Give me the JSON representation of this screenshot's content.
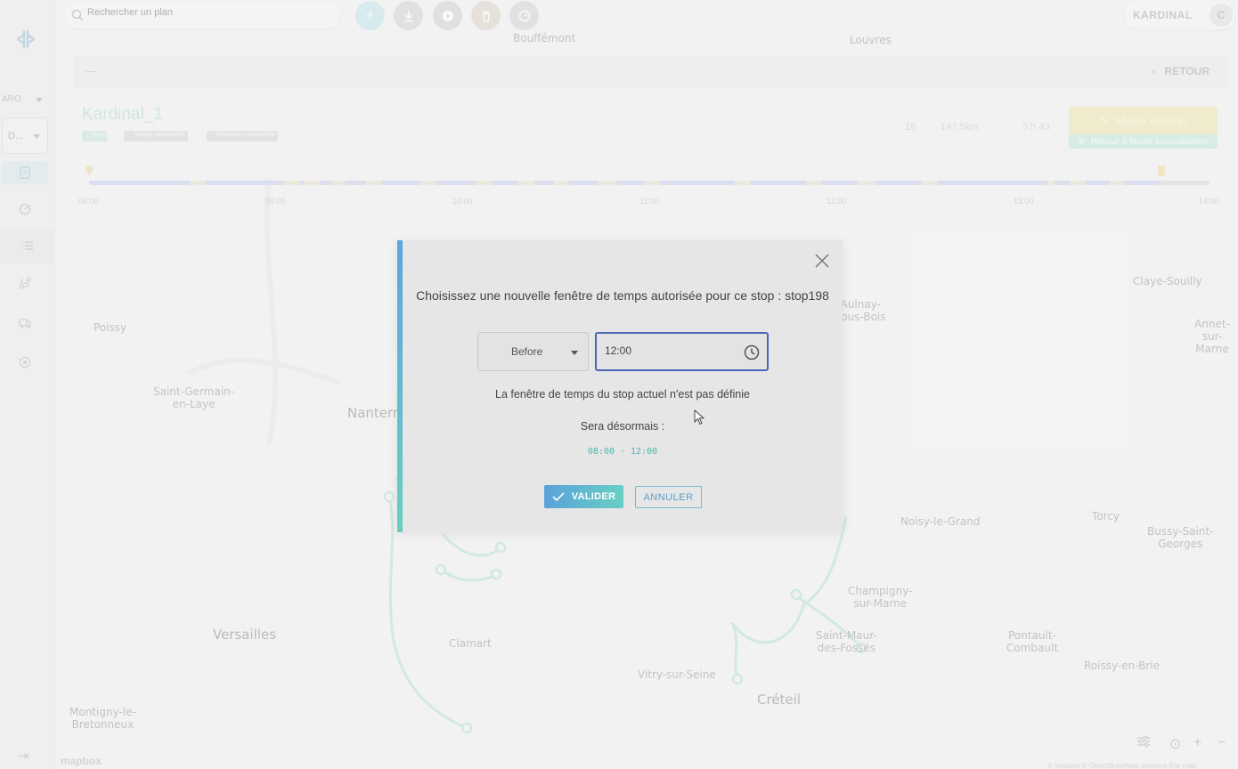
{
  "search": {
    "placeholder": "Rechercher un plan"
  },
  "user": {
    "name": "KARDINAL",
    "initial": "C"
  },
  "sidebar": {
    "label": "ARO",
    "select_value": "D..."
  },
  "subbar": {
    "back_label": "RETOUR"
  },
  "plan": {
    "title": "Kardinal_1",
    "tags": [
      "Eco",
      "Stops verrouillés",
      "Position verrouillée"
    ],
    "stats": {
      "stops": "18",
      "distance": "147,5km",
      "duration": "5 h 43"
    },
    "mode_button": "Mode édition",
    "mode_sub": "Retour à Mode consultation"
  },
  "timeline": {
    "labels": [
      "08:00",
      "09:00",
      "10:00",
      "11:00",
      "12:00",
      "13:00",
      "14:00"
    ]
  },
  "map": {
    "cities": [
      {
        "name": "Bouffémont"
      },
      {
        "name": "Louvres"
      },
      {
        "name": "Claye-Souilly"
      },
      {
        "name": "Aulnay-\nsous-Bois"
      },
      {
        "name": "Poissy"
      },
      {
        "name": "Annet-sur-\nMarne"
      },
      {
        "name": "Saint-Germain-\nen-Laye"
      },
      {
        "name": "Nanterre"
      },
      {
        "name": "Noisy-le-Grand"
      },
      {
        "name": "Torcy"
      },
      {
        "name": "Bussy-Saint-\nGeorges"
      },
      {
        "name": "Champigny-\nsur-Marne"
      },
      {
        "name": "Versailles"
      },
      {
        "name": "Clamart"
      },
      {
        "name": "Saint-Maur-\ndes-Fossés"
      },
      {
        "name": "Pontault-\nCombault"
      },
      {
        "name": "Roissy-en-Brie"
      },
      {
        "name": "Vitry-sur-Seine"
      },
      {
        "name": "Créteil"
      },
      {
        "name": "Montigny-le-\nBretonneux"
      }
    ],
    "attribution": "© Mapbox © OpenStreetMap Improve this map",
    "logo": "mapbox"
  },
  "dialog": {
    "title": "Choisissez une nouvelle fenêtre de temps autorisée pour ce stop : stop198",
    "mode_select": "Before",
    "time_value": "12:00",
    "current_info": "La fenêtre de temps du stop actuel n'est pas définie",
    "will_be_label": "Sera désormais :",
    "new_range": "08:00 - 12:00",
    "confirm_label": "VALIDER",
    "cancel_label": "ANNULER"
  },
  "colors": {
    "accent_blue": "#4a66b4",
    "accent_teal": "#68cfc3",
    "route": "#a9d9cc"
  }
}
